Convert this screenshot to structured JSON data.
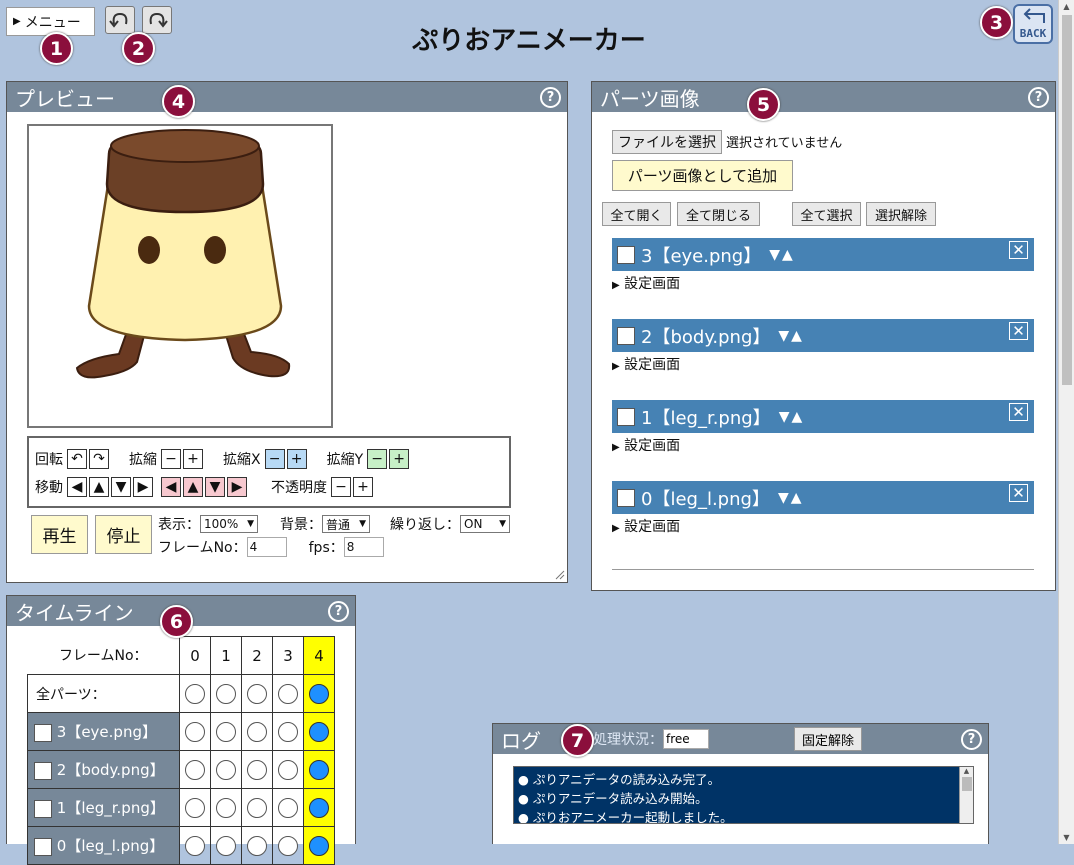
{
  "header": {
    "menu_label": "メニュー",
    "app_title": "ぷりおアニメーカー",
    "back_label": "BACK"
  },
  "badges": [
    "1",
    "2",
    "3",
    "4",
    "5",
    "6",
    "7"
  ],
  "preview": {
    "title": "プレビュー",
    "help": "?",
    "controls": {
      "rotate": "回転",
      "scale": "拡縮",
      "scale_x": "拡縮X",
      "scale_y": "拡縮Y",
      "move": "移動",
      "opacity": "不透明度"
    },
    "play": "再生",
    "stop": "停止",
    "display_label": "表示：",
    "display_value": "100%",
    "bg_label": "背景：",
    "bg_value": "普通",
    "repeat_label": "繰り返し：",
    "repeat_value": "ON",
    "frame_label": "フレームNo：",
    "frame_value": "4",
    "fps_label": "fps：",
    "fps_value": "8"
  },
  "parts": {
    "title": "パーツ画像",
    "help": "?",
    "file_button": "ファイルを選択",
    "file_status": "選択されていません",
    "add_button": "パーツ画像として追加",
    "open_all": "全て開く",
    "close_all": "全て閉じる",
    "select_all": "全て選択",
    "deselect": "選択解除",
    "settings_label": "設定画面",
    "items": [
      {
        "label": "3【eye.png】"
      },
      {
        "label": "2【body.png】"
      },
      {
        "label": "1【leg_r.png】"
      },
      {
        "label": "0【leg_l.png】"
      }
    ]
  },
  "timeline": {
    "title": "タイムライン",
    "help": "?",
    "frame_header": "フレームNo：",
    "frames": [
      "0",
      "1",
      "2",
      "3",
      "4"
    ],
    "current_frame": 4,
    "all_parts": "全パーツ：",
    "rows": [
      "3【eye.png】",
      "2【body.png】",
      "1【leg_r.png】",
      "0【leg_l.png】"
    ]
  },
  "log": {
    "title": "ログ",
    "status_label": "処理状況：",
    "status_value": "free",
    "unpin_button": "固定解除",
    "help": "?",
    "lines": [
      "ぷりアニデータの読み込み完了。",
      "ぷりアニデータ読み込み開始。",
      "ぷりおアニメーカー起動しました。"
    ]
  },
  "colors": {
    "background": "#b0c4de",
    "panel_header": "#778899",
    "part_bar": "#4682b4",
    "badge": "#8b0f3c",
    "log_bg": "#003366",
    "timeline_current": "#ffff00",
    "keyframe": "#1e90ff"
  }
}
